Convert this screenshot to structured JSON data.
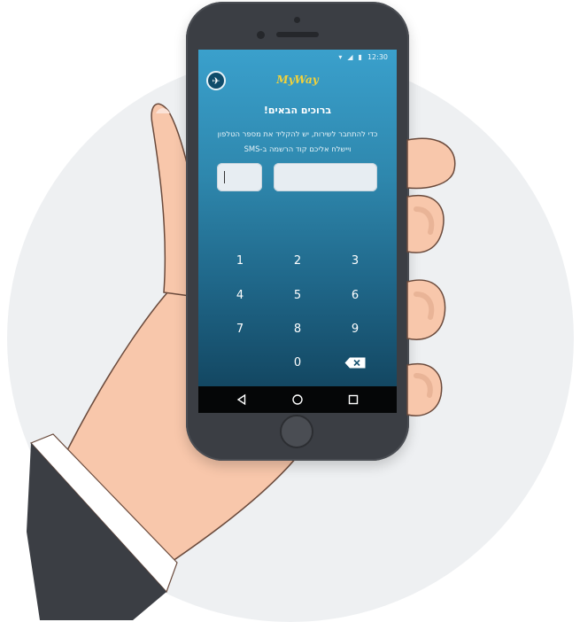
{
  "status_bar": {
    "time": "12:30",
    "wifi_icon": "wifi-icon",
    "signal_icon": "signal-icon",
    "battery_icon": "battery-icon"
  },
  "app": {
    "logo": "MyWay",
    "menu_icon": "globe-icon",
    "welcome": "ברוכים הבאים!",
    "description_line1": "כדי להתחבר לשירות, יש להקליד את מספר הטלפון",
    "description_line2": "ויישלח אליכם קוד הרשמה ב-SMS"
  },
  "inputs": {
    "prefix_value": "",
    "phone_value": ""
  },
  "keypad": {
    "k1": "1",
    "k2": "2",
    "k3": "3",
    "k4": "4",
    "k5": "5",
    "k6": "6",
    "k7": "7",
    "k8": "8",
    "k9": "9",
    "k0": "0",
    "backspace_icon": "backspace-icon"
  },
  "nav": {
    "back_icon": "back-triangle-icon",
    "home_icon": "home-circle-icon",
    "recents_icon": "recents-square-icon"
  },
  "colors": {
    "accent": "#f2d23a",
    "screen_top": "#3aa0cc",
    "screen_bottom": "#103f58",
    "phone_body": "#3b3e44"
  }
}
